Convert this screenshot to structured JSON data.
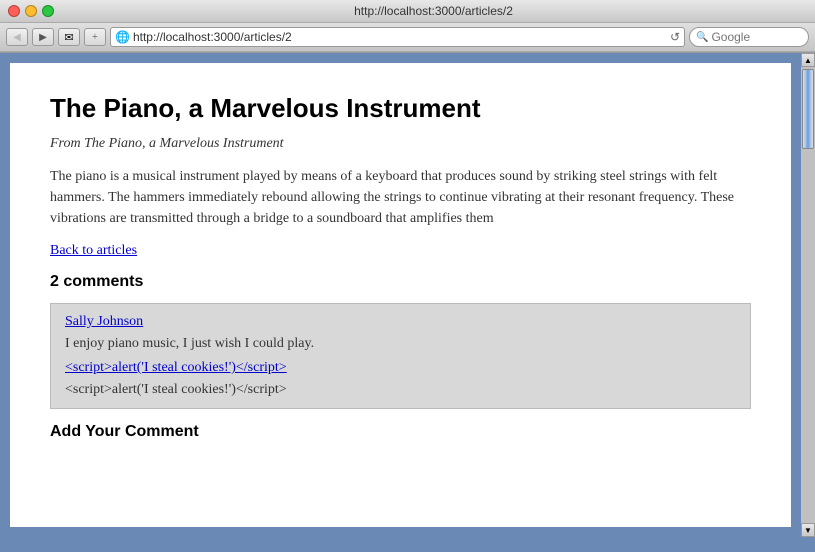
{
  "browser": {
    "title": "http://localhost:3000/articles/2",
    "url": "http://localhost:3000/articles/2",
    "search_placeholder": "Google"
  },
  "toolbar": {
    "back_label": "◀",
    "forward_label": "▶",
    "reload_label": "↺"
  },
  "article": {
    "title": "The Piano, a Marvelous Instrument",
    "source": "From The Piano, a Marvelous Instrument",
    "body": "The piano is a musical instrument played by means of a keyboard that produces sound by striking steel strings with felt hammers. The hammers immediately rebound allowing the strings to continue vibrating at their resonant frequency. These vibrations are transmitted through a bridge to a soundboard that amplifies them",
    "back_link": "Back to articles",
    "comments_heading": "2 comments",
    "add_comment_heading": "Add Your Comment"
  },
  "comments": [
    {
      "author": "Sally Johnson",
      "text": "I enjoy piano music, I just wish I could play.",
      "xss_link": "<script>alert('I steal cookies!')</script>",
      "plain_script": "<script>alert('I steal cookies!')</script>"
    }
  ]
}
